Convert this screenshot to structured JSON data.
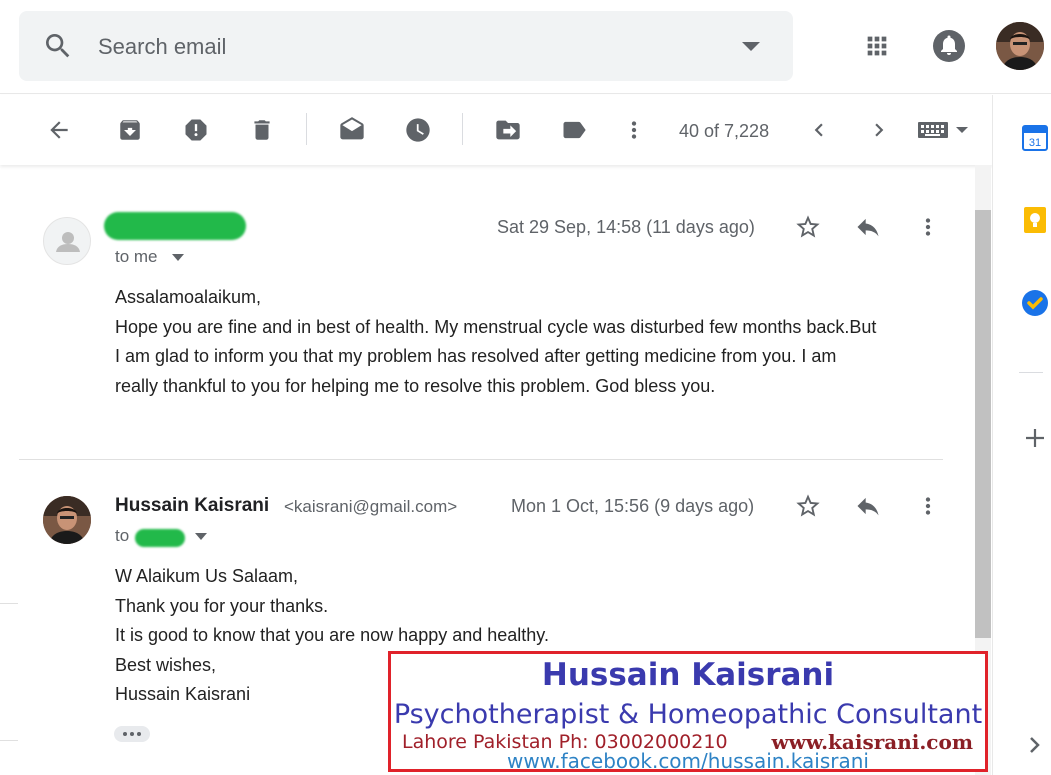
{
  "search": {
    "placeholder": "Search email"
  },
  "toolbar": {
    "pager": "40 of 7,228"
  },
  "messages": [
    {
      "date": "Sat 29 Sep, 14:58 (11 days ago)",
      "to": "to me",
      "body": [
        "Assalamoalaikum,",
        "Hope you are fine and in best of health. My menstrual cycle was disturbed few months back.But",
        "I am glad to inform you that my problem has resolved after getting medicine from you. I am",
        "really thankful to you for helping me to resolve this problem. God bless you."
      ]
    },
    {
      "sender_name": "Hussain Kaisrani",
      "sender_email": "<kaisrani@gmail.com>",
      "date": "Mon 1 Oct, 15:56 (9 days ago)",
      "to": "to",
      "body": [
        "W Alaikum Us Salaam,",
        "Thank you for your thanks.",
        "It is good to know that you are now happy and healthy.",
        "Best wishes,",
        "Hussain Kaisrani"
      ]
    }
  ],
  "stamp": {
    "name": "Hussain Kaisrani",
    "title": "Psychotherapist & Homeopathic Consultant",
    "city": "Lahore Pakistan Ph: 03002000210",
    "website": "www.kaisrani.com",
    "facebook": "www.facebook.com/hussain.kaisrani"
  },
  "rail": {
    "calendar_day": "31"
  },
  "colors": {
    "accent_blue": "#1a73e8",
    "redacted_green": "#22b94a",
    "stamp_border": "#e0222a"
  }
}
